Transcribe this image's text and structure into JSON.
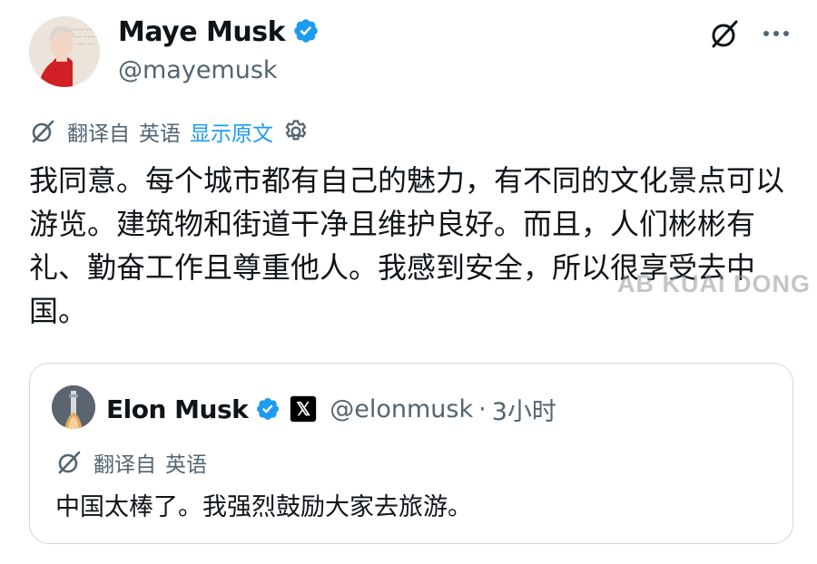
{
  "post": {
    "author": {
      "name": "Maye Musk",
      "handle": "@mayemusk",
      "verified": true,
      "avatar_icon": "avatar-photo"
    },
    "header_icons": [
      "grok-icon",
      "more-icon"
    ],
    "translation": {
      "label_prefix": "翻译自",
      "language": "英语",
      "show_original": "显示原文",
      "settings_icon": "gear-icon"
    },
    "text": "我同意。每个城市都有自己的魅力，有不同的文化景点可以游览。建筑物和街道干净且维护良好。而且，人们彬彬有礼、勤奋工作且尊重他人。我感到安全，所以很享受去中国。"
  },
  "quote": {
    "author": {
      "name": "Elon Musk",
      "handle": "@elonmusk",
      "verified": true,
      "affiliate_badge": "𝕏",
      "avatar_icon": "avatar-photo"
    },
    "separator": "·",
    "time": "3小时",
    "translation": {
      "label_prefix": "翻译自",
      "language": "英语"
    },
    "text": "中国太棒了。我强烈鼓励大家去旅游。"
  },
  "watermark": "AB KUAI DONG",
  "colors": {
    "text_primary": "#0f1419",
    "text_secondary": "#536471",
    "link": "#1d9bf0",
    "verified": "#1d9bf0",
    "border": "#cfd9de"
  }
}
